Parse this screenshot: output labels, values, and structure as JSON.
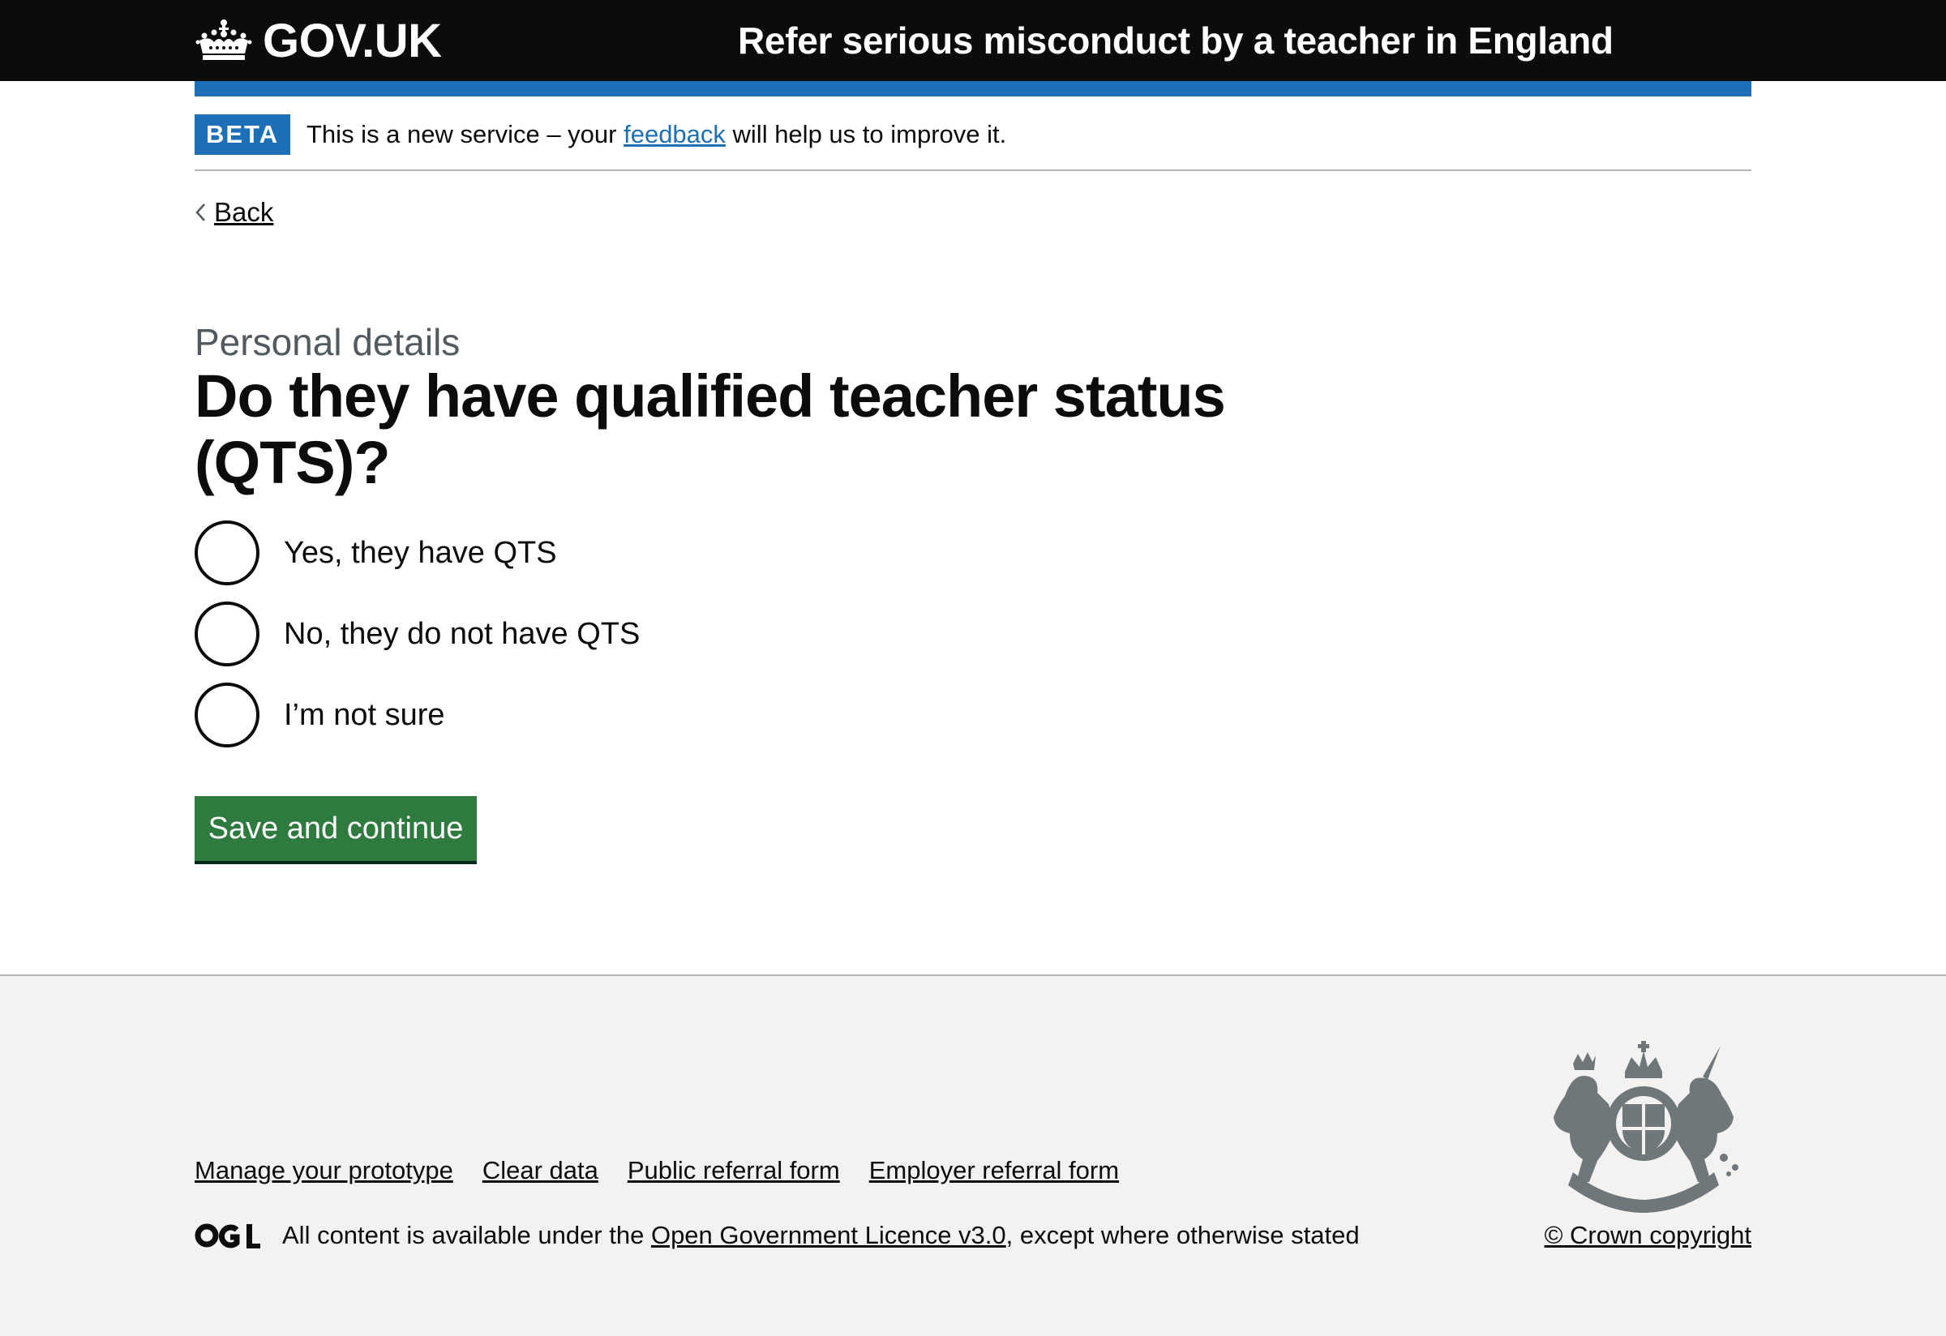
{
  "header": {
    "logo_text": "GOV.UK",
    "logo_icon": "crown-icon",
    "service_name": "Refer serious misconduct by a teacher in England"
  },
  "phase_banner": {
    "tag": "BETA",
    "text_before": "This is a new service – your ",
    "link_text": "feedback",
    "text_after": " will help us to improve it."
  },
  "back_link": {
    "icon": "chevron-left-icon",
    "label": "Back"
  },
  "main": {
    "caption": "Personal details",
    "heading": "Do they have qualified teacher status (QTS)?",
    "radios": [
      {
        "label": "Yes, they have QTS",
        "selected": false
      },
      {
        "label": "No, they do not have QTS",
        "selected": false
      },
      {
        "label": "I’m not sure",
        "selected": false
      }
    ],
    "submit_label": "Save and continue"
  },
  "footer": {
    "links": [
      "Manage your prototype",
      "Clear data",
      "Public referral form",
      "Employer referral form"
    ],
    "licence_logo": "ogl-icon",
    "licence_before": "All content is available under the ",
    "licence_link": "Open Government Licence v3.0",
    "licence_after": ", except where otherwise stated",
    "crest_icon": "royal-coat-of-arms-icon",
    "copyright": "© Crown copyright"
  },
  "colors": {
    "header_bg": "#0b0c0c",
    "brand_blue": "#1d70b8",
    "button_green": "#2f7a3f",
    "footer_bg": "#f3f2f1",
    "secondary_text": "#505a5f"
  }
}
